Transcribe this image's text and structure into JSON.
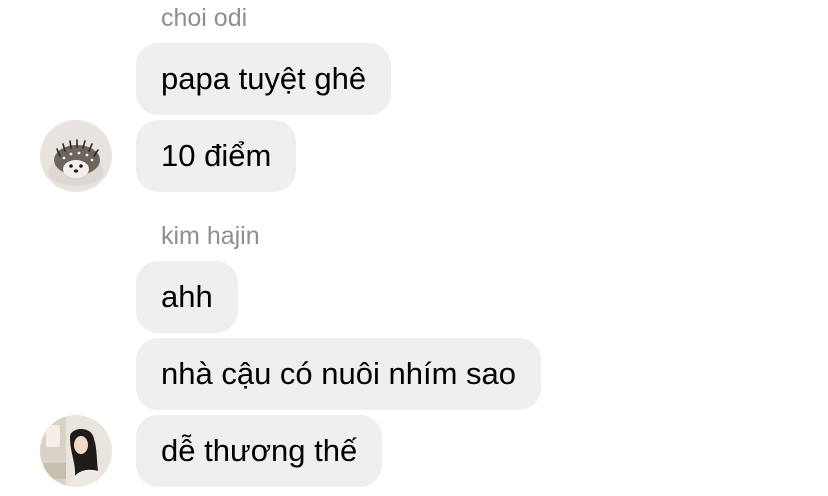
{
  "conversation": {
    "groups": [
      {
        "sender": "choi odi",
        "avatar": "hedgehog-avatar",
        "messages": [
          "papa tuyệt ghê",
          "10 điểm"
        ]
      },
      {
        "sender": "kim hajin",
        "avatar": "girl-avatar",
        "messages": [
          "ahh",
          "nhà cậu có nuôi nhím sao",
          "dễ thương thế"
        ]
      }
    ]
  },
  "colors": {
    "bubble_background": "#efefef",
    "sender_name": "#8e8e93",
    "message_text": "#000000",
    "page_background": "#ffffff"
  }
}
